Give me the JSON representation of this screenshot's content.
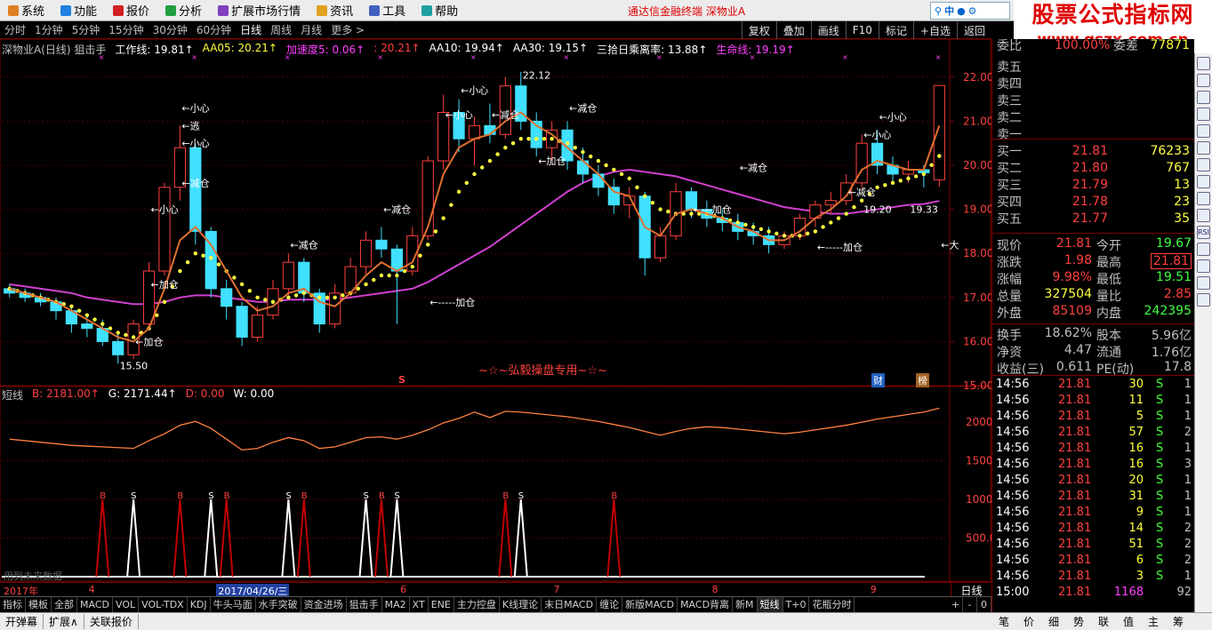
{
  "menu": [
    {
      "label": "系统",
      "icon": "system-icon",
      "color": "#e08020"
    },
    {
      "label": "功能",
      "icon": "function-icon",
      "color": "#2080e0"
    },
    {
      "label": "报价",
      "icon": "quote-icon",
      "color": "#d02020"
    },
    {
      "label": "分析",
      "icon": "analysis-icon",
      "color": "#20a040"
    },
    {
      "label": "扩展市场行情",
      "icon": "extended-market-icon",
      "color": "#8040c0"
    },
    {
      "label": "资讯",
      "icon": "news-icon",
      "color": "#e0a020"
    },
    {
      "label": "工具",
      "icon": "tools-icon",
      "color": "#4060c0"
    },
    {
      "label": "帮助",
      "icon": "help-icon",
      "color": "#20a0a0"
    }
  ],
  "app_title": "通达信金融终端   深物业A",
  "search": {
    "text": "中",
    "icons": [
      "search-icon",
      "mic-icon",
      "settings-icon"
    ]
  },
  "watermark": {
    "line1": "股票公式指标网",
    "line2": "www.gszx.com.cn"
  },
  "periods": [
    "分时",
    "1分钟",
    "5分钟",
    "15分钟",
    "30分钟",
    "60分钟",
    "日线",
    "周线",
    "月线",
    "更多 >"
  ],
  "active_period": "日线",
  "tools": [
    "复权",
    "叠加",
    "画线",
    "F10",
    "标记",
    "+自选",
    "返回"
  ],
  "main_header": [
    {
      "text": "深物业A(日线) 狙击手",
      "color": "#c0c0c0"
    },
    {
      "text": "工作线: 19.81↑",
      "color": "#ffffff"
    },
    {
      "text": "AA05: 20.21↑",
      "color": "#ffff40"
    },
    {
      "text": "加速度5: 0.06↑",
      "color": "#ff40ff"
    },
    {
      "text": ": 20.21↑",
      "color": "#ff4040"
    },
    {
      "text": "AA10: 19.94↑",
      "color": "#ffffff"
    },
    {
      "text": "AA30: 19.15↑",
      "color": "#ffffff"
    },
    {
      "text": "三拾日乘离率: 13.88↑",
      "color": "#ffffff"
    },
    {
      "text": "生命线: 19.19↑",
      "color": "#ff40ff"
    }
  ],
  "sub_header": [
    {
      "text": "短线",
      "color": "#c0c0c0"
    },
    {
      "text": "B: 2181.00↑",
      "color": "#ff4040"
    },
    {
      "text": "G: 2171.44↑",
      "color": "#ffffff"
    },
    {
      "text": "D: 0.00",
      "color": "#ff4040"
    },
    {
      "text": "W: 0.00",
      "color": "#ffffff"
    }
  ],
  "center_label": "~☆~弘毅操盘专用~☆~",
  "future_note": "用到未来数据",
  "marks": {
    "s": "S",
    "cai": "财",
    "bang": "榜"
  },
  "price_axis": [
    "22.00",
    "21.00",
    "20.00",
    "19.00",
    "18.00",
    "17.00",
    "16.00",
    "15.00"
  ],
  "sub_axis": [
    "2000",
    "1500",
    "1000",
    "500.0"
  ],
  "x_labels": [
    {
      "text": "2017年",
      "date": "2017-03"
    },
    {
      "text": "4",
      "date": "2017-04"
    },
    {
      "text": "2017/04/26/三",
      "date": "2017-04-26",
      "highlight": true
    },
    {
      "text": "6",
      "date": "2017-06"
    },
    {
      "text": "7",
      "date": "2017-07"
    },
    {
      "text": "8",
      "date": "2017-08"
    },
    {
      "text": "9",
      "date": "2017-09"
    }
  ],
  "period_label": "日线",
  "zoom": [
    "+",
    "-",
    "0"
  ],
  "annotations": [
    {
      "text": "←小心",
      "idx": 11,
      "price": 21.3
    },
    {
      "text": "←逃",
      "idx": 11,
      "price": 20.9
    },
    {
      "text": "←小心",
      "idx": 11,
      "price": 20.5
    },
    {
      "text": "←减仓",
      "idx": 11,
      "price": 19.6
    },
    {
      "text": "←小心",
      "idx": 9,
      "price": 19.0
    },
    {
      "text": "←加仓",
      "idx": 9,
      "price": 17.3
    },
    {
      "text": "←加仓",
      "idx": 8,
      "price": 16.0
    },
    {
      "text": "15.50",
      "idx": 7,
      "price": 15.45
    },
    {
      "text": "←减仓",
      "idx": 18,
      "price": 18.2
    },
    {
      "text": "←减仓",
      "idx": 24,
      "price": 19.0
    },
    {
      "text": "←-----加仓",
      "idx": 27,
      "price": 16.9
    },
    {
      "text": "←小心",
      "idx": 29,
      "price": 21.7
    },
    {
      "text": "←小心",
      "idx": 28,
      "price": 21.15
    },
    {
      "text": "←减仓",
      "idx": 31,
      "price": 21.15
    },
    {
      "text": "22.12",
      "idx": 33,
      "price": 22.05
    },
    {
      "text": "←减仓",
      "idx": 36,
      "price": 21.3
    },
    {
      "text": "←加仓",
      "idx": 34,
      "price": 20.1
    },
    {
      "text": "←减仓",
      "idx": 47,
      "price": 19.95
    },
    {
      "text": "←---加仓",
      "idx": 44,
      "price": 19.0
    },
    {
      "text": "←-----加仓",
      "idx": 52,
      "price": 18.15
    },
    {
      "text": "←减仓",
      "idx": 54,
      "price": 19.4
    },
    {
      "text": "←小心",
      "idx": 56,
      "price": 21.1
    },
    {
      "text": "←小心",
      "idx": 55,
      "price": 20.7
    },
    {
      "text": "19.20",
      "idx": 55,
      "price": 19.0
    },
    {
      "text": "19.33",
      "idx": 58,
      "price": 19.0
    },
    {
      "text": "←大",
      "idx": 60,
      "price": 18.2
    }
  ],
  "order_book": [
    {
      "label": "委比",
      "price": "100.00%",
      "extra": "委差",
      "vol": "77871"
    },
    {
      "label": "卖五",
      "price": "",
      "vol": ""
    },
    {
      "label": "卖四",
      "price": "",
      "vol": ""
    },
    {
      "label": "卖三",
      "price": "",
      "vol": ""
    },
    {
      "label": "卖二",
      "price": "",
      "vol": ""
    },
    {
      "label": "卖一",
      "price": "",
      "vol": ""
    },
    {
      "label": "买一",
      "price": "21.81",
      "vol": "76233"
    },
    {
      "label": "买二",
      "price": "21.80",
      "vol": "767"
    },
    {
      "label": "买三",
      "price": "21.79",
      "vol": "13"
    },
    {
      "label": "买四",
      "price": "21.78",
      "vol": "23"
    },
    {
      "label": "买五",
      "price": "21.77",
      "vol": "35"
    }
  ],
  "quote": [
    {
      "l1": "现价",
      "v1": "21.81",
      "c1": "#ff4040",
      "l2": "今开",
      "v2": "19.67",
      "c2": "#40ff40"
    },
    {
      "l1": "涨跌",
      "v1": "1.98",
      "c1": "#ff4040",
      "l2": "最高",
      "v2": "21.81",
      "c2": "#ff4040",
      "box": true
    },
    {
      "l1": "涨幅",
      "v1": "9.98%",
      "c1": "#ff4040",
      "l2": "最低",
      "v2": "19.51",
      "c2": "#40ff40"
    },
    {
      "l1": "总量",
      "v1": "327504",
      "c1": "#ffff40",
      "l2": "量比",
      "v2": "2.85",
      "c2": "#ff4040"
    },
    {
      "l1": "外盘",
      "v1": "85109",
      "c1": "#ff4040",
      "l2": "内盘",
      "v2": "242395",
      "c2": "#40ff40"
    },
    {
      "l1": "换手",
      "v1": "18.62%",
      "c1": "#c0c0c0",
      "l2": "股本",
      "v2": "5.96亿",
      "c2": "#c0c0c0"
    },
    {
      "l1": "净资",
      "v1": "4.47",
      "c1": "#c0c0c0",
      "l2": "流通",
      "v2": "1.76亿",
      "c2": "#c0c0c0"
    },
    {
      "l1": "收益(三)",
      "v1": "0.611",
      "c1": "#c0c0c0",
      "l2": "PE(动)",
      "v2": "17.8",
      "c2": "#c0c0c0"
    }
  ],
  "ticks": [
    {
      "time": "14:56",
      "price": "21.81",
      "vol": "30",
      "bs": "S",
      "n": "1"
    },
    {
      "time": "14:56",
      "price": "21.81",
      "vol": "11",
      "bs": "S",
      "n": "1"
    },
    {
      "time": "14:56",
      "price": "21.81",
      "vol": "5",
      "bs": "S",
      "n": "1"
    },
    {
      "time": "14:56",
      "price": "21.81",
      "vol": "57",
      "bs": "S",
      "n": "2"
    },
    {
      "time": "14:56",
      "price": "21.81",
      "vol": "16",
      "bs": "S",
      "n": "1"
    },
    {
      "time": "14:56",
      "price": "21.81",
      "vol": "16",
      "bs": "S",
      "n": "3"
    },
    {
      "time": "14:56",
      "price": "21.81",
      "vol": "20",
      "bs": "S",
      "n": "1"
    },
    {
      "time": "14:56",
      "price": "21.81",
      "vol": "31",
      "bs": "S",
      "n": "1"
    },
    {
      "time": "14:56",
      "price": "21.81",
      "vol": "9",
      "bs": "S",
      "n": "1"
    },
    {
      "time": "14:56",
      "price": "21.81",
      "vol": "14",
      "bs": "S",
      "n": "2"
    },
    {
      "time": "14:56",
      "price": "21.81",
      "vol": "51",
      "bs": "S",
      "n": "2"
    },
    {
      "time": "14:56",
      "price": "21.81",
      "vol": "6",
      "bs": "S",
      "n": "2"
    },
    {
      "time": "14:56",
      "price": "21.81",
      "vol": "3",
      "bs": "S",
      "n": "1"
    },
    {
      "time": "15:00",
      "price": "21.81",
      "vol": "1168",
      "bs": "",
      "n": "92"
    }
  ],
  "indicator_tabs": [
    "指标",
    "模板",
    "全部",
    "MACD",
    "VOL",
    "VOL-TDX",
    "KDJ",
    "牛头马面",
    "水手突破",
    "资金进场",
    "狙击手",
    "MA2",
    "XT",
    "ENE",
    "主力控盘",
    "K线理论",
    "末日MACD",
    "缠论",
    "新版MACD",
    "MACD背离",
    "新M",
    "短线",
    "T+0",
    "花瓶分时"
  ],
  "active_tab": "短线",
  "bottom": [
    "开弹幕",
    "扩展∧",
    "关联报价"
  ],
  "right_tabs": [
    "笔",
    "价",
    "细",
    "势",
    "联",
    "值",
    "主",
    "筹"
  ],
  "side_icons": [
    "minimize-icon",
    "chart-icon",
    "bar-icon",
    "kline-icon",
    "grid-icon",
    "f10-icon",
    "line-icon",
    "fund-icon",
    "list-icon",
    "bars-icon",
    "rsi-icon",
    "arrows-icon",
    "lock-icon",
    "stack-icon",
    "gear-icon"
  ],
  "chart_data": [
    {
      "type": "candlestick",
      "title": "深物业A(日线)",
      "ylim": [
        15,
        22.5
      ],
      "x_start": "2017-03",
      "candles": [
        [
          17.2,
          17.3,
          17.0,
          17.1
        ],
        [
          17.1,
          17.2,
          16.9,
          17.0
        ],
        [
          17.0,
          17.1,
          16.8,
          16.9
        ],
        [
          16.9,
          17.0,
          16.5,
          16.7
        ],
        [
          16.7,
          16.8,
          16.2,
          16.4
        ],
        [
          16.4,
          16.6,
          16.1,
          16.3
        ],
        [
          16.3,
          16.5,
          15.9,
          16.0
        ],
        [
          16.0,
          16.2,
          15.5,
          15.7
        ],
        [
          15.7,
          16.5,
          15.6,
          16.4
        ],
        [
          16.4,
          17.8,
          16.3,
          17.6
        ],
        [
          17.6,
          19.6,
          17.5,
          19.5
        ],
        [
          19.5,
          20.9,
          19.2,
          20.4
        ],
        [
          20.4,
          20.5,
          18.2,
          18.5
        ],
        [
          18.5,
          18.6,
          17.0,
          17.2
        ],
        [
          17.2,
          17.4,
          16.5,
          16.8
        ],
        [
          16.8,
          16.9,
          15.9,
          16.1
        ],
        [
          16.1,
          16.8,
          16.0,
          16.6
        ],
        [
          16.6,
          17.4,
          16.5,
          17.2
        ],
        [
          17.2,
          18.0,
          17.0,
          17.8
        ],
        [
          17.8,
          17.9,
          16.9,
          17.1
        ],
        [
          17.1,
          17.2,
          16.2,
          16.4
        ],
        [
          16.4,
          17.3,
          16.3,
          17.1
        ],
        [
          17.1,
          17.9,
          17.0,
          17.7
        ],
        [
          17.7,
          18.5,
          17.5,
          18.3
        ],
        [
          18.3,
          18.6,
          17.9,
          18.1
        ],
        [
          18.1,
          18.2,
          16.4,
          17.6
        ],
        [
          17.6,
          18.6,
          17.5,
          18.4
        ],
        [
          18.4,
          20.2,
          18.3,
          20.1
        ],
        [
          20.1,
          21.6,
          19.9,
          21.2
        ],
        [
          21.2,
          21.5,
          20.3,
          20.6
        ],
        [
          20.6,
          21.1,
          20.0,
          20.9
        ],
        [
          20.9,
          21.4,
          20.5,
          20.7
        ],
        [
          20.7,
          22.0,
          20.6,
          21.8
        ],
        [
          21.8,
          22.12,
          20.8,
          21.0
        ],
        [
          21.0,
          21.2,
          20.2,
          20.4
        ],
        [
          20.4,
          21.0,
          20.1,
          20.8
        ],
        [
          20.8,
          21.0,
          19.9,
          20.1
        ],
        [
          20.1,
          20.4,
          19.6,
          19.8
        ],
        [
          19.8,
          20.0,
          19.3,
          19.5
        ],
        [
          19.5,
          19.7,
          18.9,
          19.1
        ],
        [
          19.1,
          19.5,
          18.8,
          19.3
        ],
        [
          19.3,
          19.4,
          17.5,
          17.9
        ],
        [
          17.9,
          18.6,
          17.8,
          18.4
        ],
        [
          18.4,
          19.6,
          18.3,
          19.4
        ],
        [
          19.4,
          19.5,
          18.8,
          19.0
        ],
        [
          19.0,
          19.2,
          18.6,
          18.8
        ],
        [
          18.8,
          19.0,
          18.5,
          18.7
        ],
        [
          18.7,
          18.9,
          18.3,
          18.5
        ],
        [
          18.5,
          18.7,
          18.2,
          18.4
        ],
        [
          18.4,
          18.6,
          18.0,
          18.2
        ],
        [
          18.2,
          18.5,
          18.1,
          18.4
        ],
        [
          18.4,
          18.9,
          18.3,
          18.8
        ],
        [
          18.8,
          19.2,
          18.6,
          19.1
        ],
        [
          19.1,
          19.4,
          18.9,
          19.2
        ],
        [
          19.2,
          19.8,
          19.1,
          19.6
        ],
        [
          19.6,
          20.7,
          19.5,
          20.5
        ],
        [
          20.5,
          20.8,
          19.8,
          20.0
        ],
        [
          20.0,
          20.2,
          19.6,
          19.8
        ],
        [
          19.8,
          20.1,
          19.6,
          19.9
        ],
        [
          19.9,
          20.0,
          19.5,
          19.83
        ],
        [
          19.67,
          21.81,
          19.51,
          21.81
        ]
      ],
      "ma_worker": [
        17.2,
        17.1,
        17.0,
        16.9,
        16.7,
        16.5,
        16.3,
        16.1,
        16.0,
        16.3,
        17.2,
        18.3,
        18.6,
        18.2,
        17.6,
        17.0,
        16.7,
        16.8,
        17.1,
        17.2,
        16.9,
        16.8,
        17.1,
        17.5,
        17.8,
        17.6,
        17.8,
        18.6,
        19.8,
        20.4,
        20.6,
        20.7,
        21.0,
        21.2,
        20.9,
        20.7,
        20.4,
        20.1,
        19.8,
        19.4,
        19.3,
        18.6,
        18.4,
        18.9,
        19.0,
        18.9,
        18.8,
        18.6,
        18.5,
        18.3,
        18.3,
        18.5,
        18.8,
        19.0,
        19.3,
        19.9,
        20.1,
        20.0,
        19.9,
        19.9,
        20.9
      ],
      "aa05": [
        17.2,
        17.1,
        17.0,
        16.9,
        16.8,
        16.6,
        16.4,
        16.2,
        16.1,
        16.3,
        16.9,
        17.6,
        18.0,
        17.9,
        17.6,
        17.3,
        17.0,
        16.9,
        17.0,
        17.1,
        17.0,
        17.0,
        17.1,
        17.3,
        17.5,
        17.5,
        17.7,
        18.2,
        18.8,
        19.4,
        19.8,
        20.1,
        20.4,
        20.6,
        20.6,
        20.6,
        20.5,
        20.3,
        20.1,
        19.9,
        19.7,
        19.3,
        19.0,
        18.9,
        18.9,
        18.9,
        18.8,
        18.7,
        18.6,
        18.5,
        18.4,
        18.4,
        18.5,
        18.7,
        18.9,
        19.2,
        19.5,
        19.6,
        19.7,
        19.8,
        20.21
      ],
      "life_line": [
        17.3,
        17.25,
        17.2,
        17.15,
        17.1,
        17.0,
        16.95,
        16.9,
        16.85,
        16.85,
        16.9,
        17.0,
        17.05,
        17.05,
        17.0,
        16.95,
        16.9,
        16.9,
        16.95,
        16.95,
        16.95,
        16.95,
        17.0,
        17.05,
        17.1,
        17.15,
        17.2,
        17.35,
        17.55,
        17.75,
        17.95,
        18.15,
        18.4,
        18.65,
        18.9,
        19.15,
        19.4,
        19.6,
        19.75,
        19.85,
        19.9,
        19.85,
        19.8,
        19.75,
        19.65,
        19.55,
        19.45,
        19.35,
        19.25,
        19.15,
        19.05,
        19.0,
        18.95,
        18.9,
        18.9,
        18.95,
        19.0,
        19.05,
        19.1,
        19.12,
        19.19
      ]
    },
    {
      "type": "line",
      "title": "短线",
      "ylim": [
        0,
        2300
      ],
      "series": [
        {
          "name": "B",
          "values": [
            1780,
            1760,
            1740,
            1720,
            1700,
            1690,
            1680,
            1670,
            1660,
            1760,
            1850,
            1960,
            2010,
            1920,
            1780,
            1640,
            1660,
            1740,
            1800,
            1760,
            1660,
            1680,
            1740,
            1800,
            1810,
            1780,
            1830,
            1900,
            1990,
            2050,
            2130,
            2060,
            2140,
            2130,
            2110,
            2090,
            2070,
            2040,
            2010,
            1970,
            1930,
            1880,
            1830,
            1880,
            1920,
            1940,
            1930,
            1910,
            1890,
            1870,
            1850,
            1870,
            1900,
            1930,
            1960,
            2000,
            2040,
            2070,
            2100,
            2130,
            2181
          ]
        }
      ],
      "signals": [
        {
          "idx": 6,
          "label": "B",
          "color": "#c00000"
        },
        {
          "idx": 8,
          "label": "S",
          "color": "#ffffff"
        },
        {
          "idx": 11,
          "label": "B",
          "color": "#c00000"
        },
        {
          "idx": 13,
          "label": "S",
          "color": "#ffffff"
        },
        {
          "idx": 14,
          "label": "B",
          "color": "#c00000"
        },
        {
          "idx": 18,
          "label": "S",
          "color": "#ffffff"
        },
        {
          "idx": 19,
          "label": "B",
          "color": "#c00000"
        },
        {
          "idx": 23,
          "label": "S",
          "color": "#ffffff"
        },
        {
          "idx": 24,
          "label": "B",
          "color": "#c00000"
        },
        {
          "idx": 25,
          "label": "S",
          "color": "#ffffff"
        },
        {
          "idx": 32,
          "label": "B",
          "color": "#c00000"
        },
        {
          "idx": 33,
          "label": "S",
          "color": "#ffffff"
        },
        {
          "idx": 39,
          "label": "B",
          "color": "#c00000"
        }
      ]
    }
  ]
}
